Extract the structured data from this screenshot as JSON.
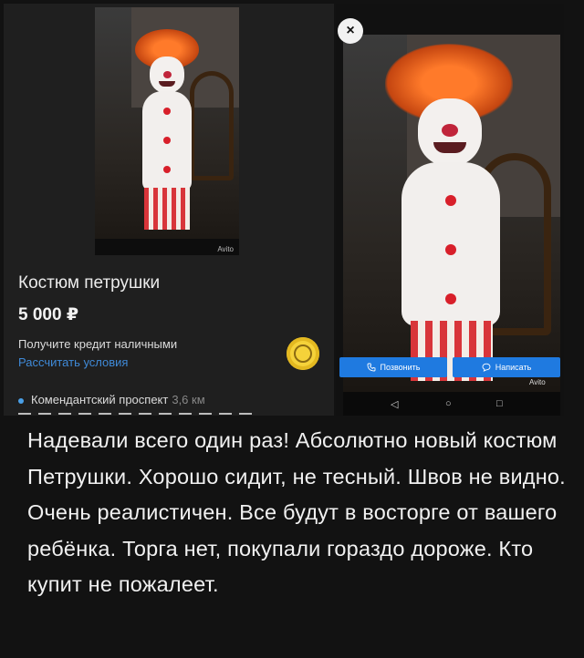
{
  "listing": {
    "title": "Костюм петрушки",
    "price": "5 000 ₽",
    "credit_text": "Получите кредит наличными",
    "credit_link": "Рассчитать условия",
    "address": "Комендантский проспект",
    "distance": "3,6 км",
    "thumb_watermark": "Avito"
  },
  "preview": {
    "close_label": "×",
    "call_label": "Позвонить",
    "message_label": "Написать",
    "watermark": "Avito",
    "nav_back": "◁",
    "nav_home": "○",
    "nav_recent": "□"
  },
  "description": "Надевали всего один раз! Абсолютно новый костюм Петрушки. Хорошо сидит, не тесный. Швов не видно. Очень реалистичен. Все будут в восторге от вашего ребёнка. Торга нет, покупали гораздо дороже. Кто купит не пожалеет.",
  "colors": {
    "accent": "#1f7ae0",
    "link": "#3f8ad8",
    "background": "#121212"
  }
}
